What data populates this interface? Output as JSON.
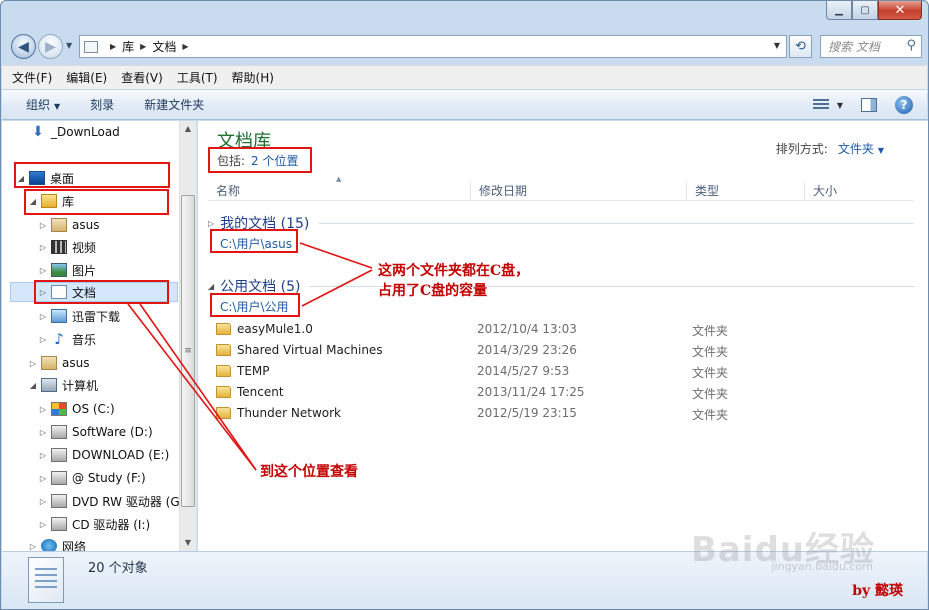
{
  "address": {
    "crumbs": [
      "库",
      "文档"
    ],
    "search_placeholder": "搜索 文档"
  },
  "menu": [
    "文件(F)",
    "编辑(E)",
    "查看(V)",
    "工具(T)",
    "帮助(H)"
  ],
  "toolbar": {
    "organize": "组织",
    "burn": "刻录",
    "new_folder": "新建文件夹"
  },
  "nav": {
    "items": [
      {
        "label": "_DownLoad"
      },
      {
        "label": "桌面"
      },
      {
        "label": "库"
      },
      {
        "label": "asus"
      },
      {
        "label": "视频"
      },
      {
        "label": "图片"
      },
      {
        "label": "文档"
      },
      {
        "label": "迅雷下载"
      },
      {
        "label": "音乐"
      },
      {
        "label": "asus"
      },
      {
        "label": "计算机"
      },
      {
        "label": "OS (C:)"
      },
      {
        "label": "SoftWare (D:)"
      },
      {
        "label": "DOWNLOAD (E:)"
      },
      {
        "label": "@ Study  (F:)"
      },
      {
        "label": "DVD RW 驱动器 (G:"
      },
      {
        "label": "CD 驱动器 (I:)"
      },
      {
        "label": "网络"
      }
    ]
  },
  "library": {
    "title": "文档库",
    "includes_label": "包括:",
    "includes_value": "2 个位置",
    "arrange_label": "排列方式:",
    "arrange_value": "文件夹"
  },
  "columns": [
    "名称",
    "修改日期",
    "类型",
    "大小"
  ],
  "groups": [
    {
      "title": "我的文档 (15)",
      "path": "C:\\用户\\asus"
    },
    {
      "title": "公用文档 (5)",
      "path": "C:\\用户\\公用"
    }
  ],
  "files": [
    {
      "name": "easyMule1.0",
      "date": "2012/10/4 13:03",
      "type": "文件夹"
    },
    {
      "name": "Shared Virtual Machines",
      "date": "2014/3/29 23:26",
      "type": "文件夹"
    },
    {
      "name": "TEMP",
      "date": "2014/5/27 9:53",
      "type": "文件夹"
    },
    {
      "name": "Tencent",
      "date": "2013/11/24 17:25",
      "type": "文件夹"
    },
    {
      "name": "Thunder Network",
      "date": "2012/5/19 23:15",
      "type": "文件夹"
    }
  ],
  "details": {
    "count": "20 个对象",
    "signature": "by  懿瑛",
    "watermark": "Baidu经验",
    "watermark_url": "jingyan.baidu.com"
  },
  "annotations": {
    "note1_line1": "这两个文件夹都在C盘，",
    "note1_line2": "占用了C盘的容量",
    "note2": "到这个位置查看"
  },
  "colors": {
    "annotation_red": "#e31414",
    "library_title": "#1f6f2f",
    "link_blue": "#1f5aa6"
  }
}
